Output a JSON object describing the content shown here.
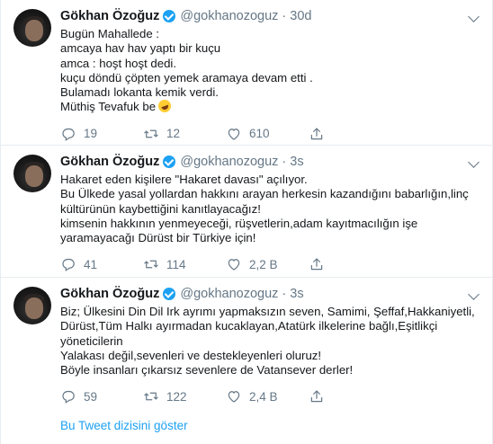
{
  "tweets": [
    {
      "name": "Gökhan Özoğuz",
      "handle": "@gokhanozoguz",
      "time": "30d",
      "lines": [
        "Bugün Mahallede :",
        "amcaya hav hav yaptı bir kuçu",
        "amca : hoşt hoşt dedi.",
        "kuçu döndü çöpten yemek aramaya  devam etti .",
        "Bulamadı lokanta kemik verdi.",
        "Müthiş Tevafuk be"
      ],
      "emoji": "rolling-on-the-floor-laughing-emoji",
      "replies": "19",
      "retweets": "12",
      "likes": "610"
    },
    {
      "name": "Gökhan Özoğuz",
      "handle": "@gokhanozoguz",
      "time": "3s",
      "lines": [
        "Hakaret eden kişilere \"Hakaret davası\" açılıyor.",
        "Bu Ülkede yasal yollardan hakkını arayan herkesin kazandığını babarlığın,linç",
        "kültürünün kaybettiğini kanıtlayacağız!",
        "kimsenin hakkının yenmeyeceği, rüşvetlerin,adam kayıtmacılığın işe",
        "yaramayacağı  Dürüst bir Türkiye için!"
      ],
      "replies": "41",
      "retweets": "114",
      "likes": "2,2 B"
    },
    {
      "name": "Gökhan Özoğuz",
      "handle": "@gokhanozoguz",
      "time": "3s",
      "lines": [
        "Biz; Ülkesini Din Dil Irk ayrımı yapmaksızın seven, Samimi, Şeffaf,Hakkaniyetli,",
        "Dürüst,Tüm Halkı ayırmadan kucaklayan,Atatürk ilkelerine bağlı,Eşitlikçi",
        "yöneticilerin",
        "Yalakası değil,sevenleri ve destekleyenleri oluruz!",
        "Böyle insanları çıkarsız sevenlere de Vatansever derler!"
      ],
      "replies": "59",
      "retweets": "122",
      "likes": "2,4 B"
    }
  ],
  "show_thread": "Bu Tweet dizisini göster",
  "colors": {
    "accent": "#1da1f2",
    "secondary_text": "#657786",
    "border": "#e6ecf0"
  }
}
